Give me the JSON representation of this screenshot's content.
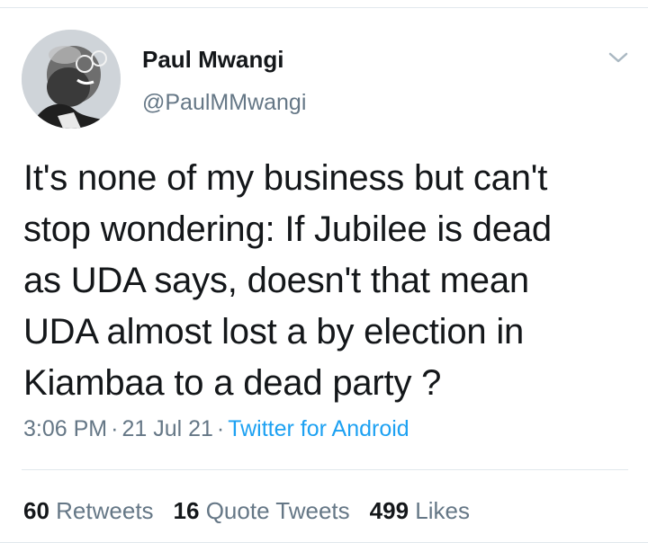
{
  "author": {
    "display_name": "Paul Mwangi",
    "handle": "@PaulMMwangi",
    "avatar_icon": "user-avatar-photo"
  },
  "tweet": {
    "text": "It's none of my business but can't\nstop wondering: If Jubilee is dead\nas UDA says, doesn't that mean\nUDA almost lost a by election in\nKiambaa to a dead party ?",
    "time": "3:06 PM",
    "separator": "·",
    "date": "21 Jul 21",
    "source": "Twitter for Android"
  },
  "stats": {
    "retweets_count": "60",
    "retweets_label": "Retweets",
    "quotes_count": "16",
    "quotes_label": "Quote Tweets",
    "likes_count": "499",
    "likes_label": "Likes"
  },
  "colors": {
    "text": "#14171a",
    "secondary": "#657786",
    "link": "#1da1f2",
    "divider": "#e1e8ed"
  }
}
